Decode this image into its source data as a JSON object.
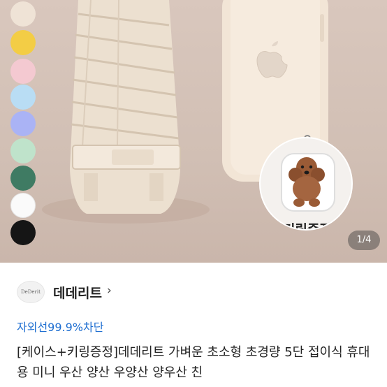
{
  "colors": {
    "swatches": [
      "#efe3d6",
      "#f3cd45",
      "#f4c9d1",
      "#b9ddf4",
      "#aab3f5",
      "#bfe3cb",
      "#3f7b63",
      "#fafafa",
      "#151515"
    ],
    "link_blue": "#1f6fd1"
  },
  "gallery": {
    "sticker_label": "키링증정",
    "counter": "1/4"
  },
  "store": {
    "logo_text": "DeDerit",
    "name": "데데리트",
    "chevron": "›"
  },
  "badge": "자외선99.9%차단",
  "product_title": "[케이스+키링증정]데데리트 가벼운 초소형 초경량 5단 접이식 휴대용 미니 우산 양산 우양산 양우산 친"
}
